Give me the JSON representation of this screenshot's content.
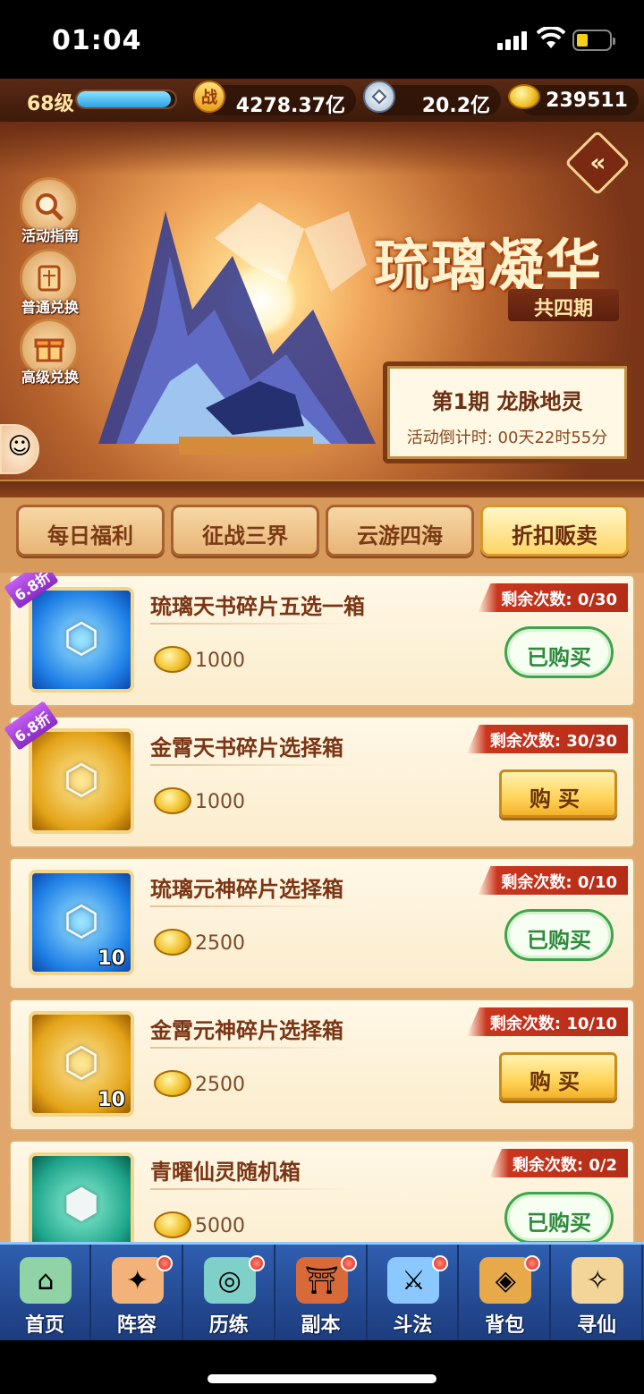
{
  "status_bar": {
    "time": "01:04"
  },
  "resources": {
    "level": "68级",
    "xp_fraction": 0.95,
    "power_icon": "战",
    "power": "4278.37亿",
    "silver": "20.2亿",
    "gold": "239511"
  },
  "banner": {
    "title": "琉璃凝华",
    "subtitle": "共四期",
    "period_title": "第1期  龙脉地灵",
    "countdown_label": "活动倒计时:",
    "countdown_value": "00天22时55分"
  },
  "side_buttons": [
    {
      "label": "活动指南",
      "icon": "magnifier-icon"
    },
    {
      "label": "普通兑换",
      "icon": "scroll-icon"
    },
    {
      "label": "高级兑换",
      "icon": "gift-icon"
    }
  ],
  "tabs": [
    {
      "label": "每日福利",
      "active": false
    },
    {
      "label": "征战三界",
      "active": false
    },
    {
      "label": "云游四海",
      "active": false
    },
    {
      "label": "折扣贩卖",
      "active": true
    }
  ],
  "items": [
    {
      "name": "琉璃天书碎片五选一箱",
      "price": "1000",
      "remaining": "剩余次数: 0/30",
      "discount": "6.8折",
      "button": "已购买",
      "bought": true,
      "color": "blue",
      "qty": ""
    },
    {
      "name": "金霄天书碎片选择箱",
      "price": "1000",
      "remaining": "剩余次数: 30/30",
      "discount": "6.8折",
      "button": "购买",
      "bought": false,
      "color": "gold",
      "qty": ""
    },
    {
      "name": "琉璃元神碎片选择箱",
      "price": "2500",
      "remaining": "剩余次数: 0/10",
      "discount": "",
      "button": "已购买",
      "bought": true,
      "color": "blue",
      "qty": "10"
    },
    {
      "name": "金霄元神碎片选择箱",
      "price": "2500",
      "remaining": "剩余次数: 10/10",
      "discount": "",
      "button": "购买",
      "bought": false,
      "color": "gold",
      "qty": "10"
    },
    {
      "name": "青曜仙灵随机箱",
      "price": "5000",
      "remaining": "剩余次数: 0/2",
      "discount": "",
      "button": "已购买",
      "bought": true,
      "color": "teal",
      "qty": ""
    }
  ],
  "bottom_nav": [
    {
      "label": "首页",
      "badge": false,
      "icon": "home-icon"
    },
    {
      "label": "阵容",
      "badge": true,
      "icon": "lineup-icon"
    },
    {
      "label": "历练",
      "badge": true,
      "icon": "training-icon"
    },
    {
      "label": "副本",
      "badge": true,
      "icon": "dungeon-icon"
    },
    {
      "label": "斗法",
      "badge": true,
      "icon": "battle-icon"
    },
    {
      "label": "背包",
      "badge": true,
      "icon": "backpack-icon"
    },
    {
      "label": "寻仙",
      "badge": false,
      "icon": "seek-immortal-icon"
    }
  ]
}
